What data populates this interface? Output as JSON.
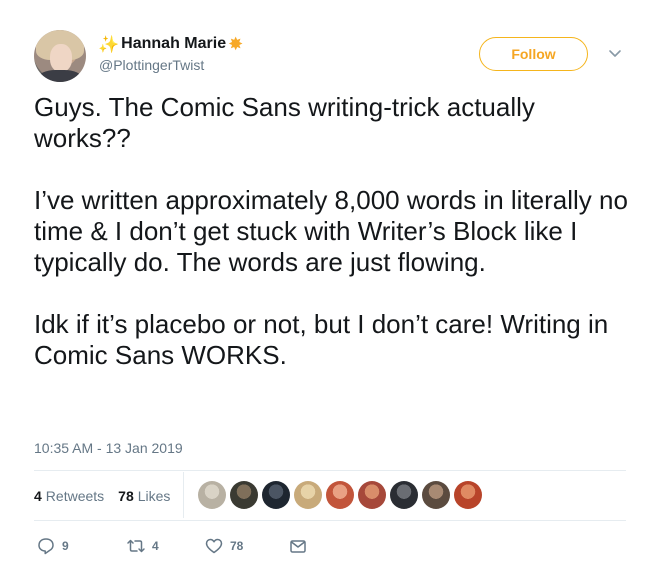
{
  "user": {
    "name": "Hannah Marie",
    "handle": "@PlottingerTwist",
    "follow_label": "Follow"
  },
  "tweet": {
    "paragraphs": [
      "Guys. The Comic Sans writing-trick actually works??",
      "I’ve written approximately 8,000 words in literally no time & I don’t get stuck with Writer’s Block like I typically do. The words are just flowing.",
      "Idk if it’s placebo or not, but I don’t care! Writing in Comic Sans WORKS."
    ],
    "timestamp": "10:35 AM - 13 Jan 2019"
  },
  "stats": {
    "retweets_count": "4",
    "retweets_label": "Retweets",
    "likes_count": "78",
    "likes_label": "Likes"
  },
  "likers": [
    {
      "color": "#b8b1a3",
      "ring": "#d9d3c6"
    },
    {
      "color": "#3a3a32",
      "ring": "#7f6f5a"
    },
    {
      "color": "#1e2630",
      "ring": "#4b5563"
    },
    {
      "color": "#c8aa7a",
      "ring": "#e7d3a8"
    },
    {
      "color": "#c2553b",
      "ring": "#e9a184"
    },
    {
      "color": "#a6483a",
      "ring": "#d98d6a"
    },
    {
      "color": "#2a2d33",
      "ring": "#6a6d73"
    },
    {
      "color": "#5b4b3f",
      "ring": "#a88a73"
    },
    {
      "color": "#b8442a",
      "ring": "#e08a63"
    }
  ],
  "actions": {
    "reply_count": "9",
    "retweet_count": "4",
    "like_count": "78"
  },
  "colors": {
    "accent": "#f5a623",
    "text": "#14171a",
    "muted": "#657786",
    "divider": "#e6ecf0"
  },
  "icons": {
    "name_left": "sparkles-icon",
    "name_right": "sun-star-icon",
    "caret": "chevron-down-icon",
    "reply": "reply-icon",
    "retweet": "retweet-icon",
    "like": "heart-icon",
    "dm": "envelope-icon"
  }
}
